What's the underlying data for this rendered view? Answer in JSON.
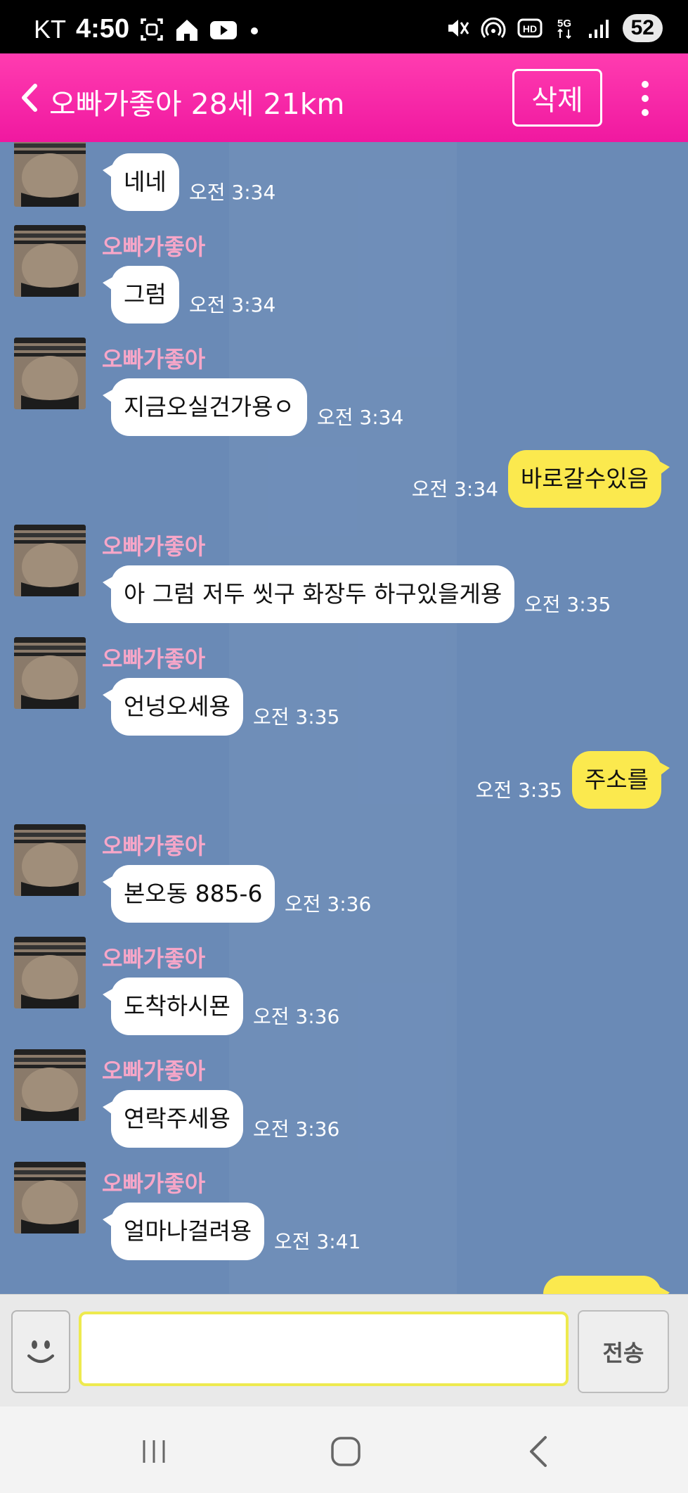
{
  "status_bar": {
    "carrier": "KT",
    "time": "4:50",
    "battery": "52"
  },
  "header": {
    "title": "오빠가좋아 28세 21km",
    "delete_label": "삭제"
  },
  "colors": {
    "header_pink": "#f52aa8",
    "chat_bg": "#6a8ab6",
    "bubble_out": "#fbe94e",
    "sender_name": "#f7a6c8",
    "input_border": "#eeea4f"
  },
  "messages": [
    {
      "dir": "in",
      "sender": "",
      "text": "네네",
      "time": "오전 3:34"
    },
    {
      "dir": "in",
      "sender": "오빠가좋아",
      "text": "그럼",
      "time": "오전 3:34"
    },
    {
      "dir": "in",
      "sender": "오빠가좋아",
      "text": "지금오실건가용ㅇ",
      "time": "오전 3:34"
    },
    {
      "dir": "out",
      "text": "바로갈수있음",
      "time": "오전 3:34"
    },
    {
      "dir": "in",
      "sender": "오빠가좋아",
      "text": "아 그럼 저두 씻구 화장두 하구있을게용",
      "time": "오전 3:35"
    },
    {
      "dir": "in",
      "sender": "오빠가좋아",
      "text": "언넝오세용",
      "time": "오전 3:35"
    },
    {
      "dir": "out",
      "text": "주소를",
      "time": "오전 3:35"
    },
    {
      "dir": "in",
      "sender": "오빠가좋아",
      "text": "본오동 885-6",
      "time": "오전 3:36"
    },
    {
      "dir": "in",
      "sender": "오빠가좋아",
      "text": "도착하시묜",
      "time": "오전 3:36"
    },
    {
      "dir": "in",
      "sender": "오빠가좋아",
      "text": "연락주세용",
      "time": "오전 3:36"
    },
    {
      "dir": "in",
      "sender": "오빠가좋아",
      "text": "얼마나걸려용",
      "time": "오전 3:41"
    }
  ],
  "input": {
    "value": "",
    "send_label": "전송"
  },
  "icons": {
    "back": "chevron-left-icon",
    "menu": "kebab-menu-icon",
    "emoji": "smiley-icon",
    "nav_recent": "recent-apps-icon",
    "nav_home": "home-icon",
    "nav_back": "back-icon"
  }
}
